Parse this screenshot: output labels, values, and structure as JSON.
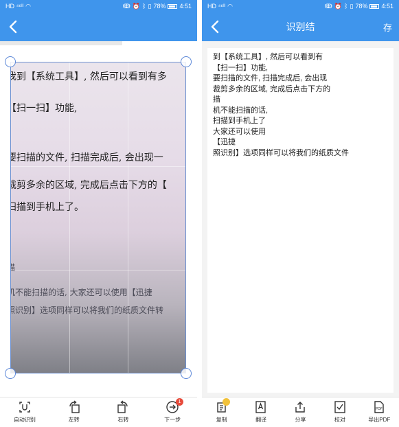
{
  "status": {
    "left_signal": "HD ⁴⁶ᴵᴵ",
    "battery": "78%",
    "time": "4:51"
  },
  "left_screen": {
    "photo_lines": [
      "我到【系统工具】, 然后可以看到有多",
      "【扫一扫】功能,",
      "要扫描的文件, 扫描完成后, 会出现一",
      "裁剪多余的区域, 完成后点击下方的【",
      "扫描到手机上了。",
      "描",
      "机不能扫描的话, 大家还可以使用【迅捷",
      "照识别】选项同样可以将我们的纸质文件转"
    ],
    "toolbar": [
      {
        "label": "自动识别",
        "icon": "auto-detect-icon"
      },
      {
        "label": "左转",
        "icon": "rotate-left-icon"
      },
      {
        "label": "右转",
        "icon": "rotate-right-icon"
      },
      {
        "label": "下一步",
        "icon": "next-step-icon",
        "badge": "1"
      }
    ]
  },
  "right_screen": {
    "title": "识别结",
    "save": "存",
    "ocr_lines": [
      "到【系统工具】, 然后可以看到有",
      "【扫一扫】功能,",
      "要扫描的文件, 扫描完成后, 会出现",
      "裁剪多余的区域, 完成后点击下方的",
      "描",
      "机不能扫描的话,",
      "扫描到手机上了",
      "大家还可以使用",
      "【迅捷",
      "照识别】选项同样可以将我们的纸质文件"
    ],
    "toolbar": [
      {
        "label": "复制",
        "icon": "copy-icon"
      },
      {
        "label": "翻译",
        "icon": "translate-icon"
      },
      {
        "label": "分享",
        "icon": "share-icon"
      },
      {
        "label": "校对",
        "icon": "proofread-icon"
      },
      {
        "label": "导出PDF",
        "icon": "export-pdf-icon"
      }
    ]
  },
  "colors": {
    "brand_blue": "#3f95ec",
    "badge_red": "#e74c3c",
    "badge_yellow": "#f2c23a"
  }
}
